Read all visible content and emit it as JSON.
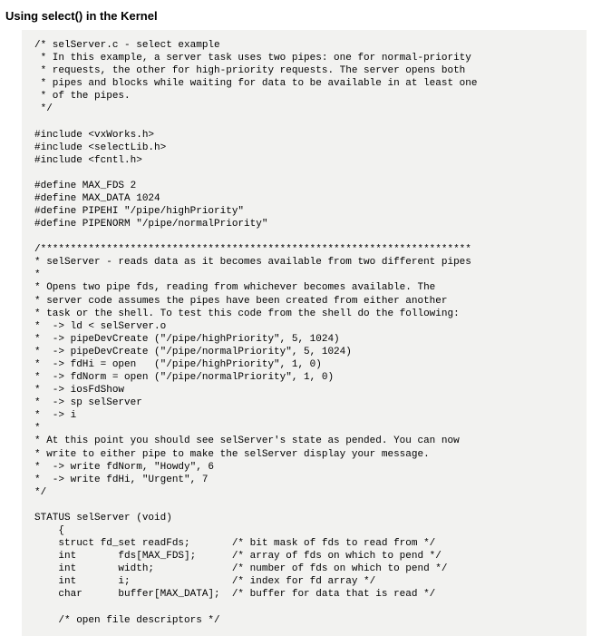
{
  "heading": "Using select() in the Kernel",
  "code": "/* selServer.c - select example\n * In this example, a server task uses two pipes: one for normal-priority\n * requests, the other for high-priority requests. The server opens both\n * pipes and blocks while waiting for data to be available in at least one\n * of the pipes.\n */\n\n#include <vxWorks.h>\n#include <selectLib.h>\n#include <fcntl.h>\n\n#define MAX_FDS 2\n#define MAX_DATA 1024\n#define PIPEHI \"/pipe/highPriority\"\n#define PIPENORM \"/pipe/normalPriority\"\n\n/************************************************************************\n* selServer - reads data as it becomes available from two different pipes\n*\n* Opens two pipe fds, reading from whichever becomes available. The\n* server code assumes the pipes have been created from either another\n* task or the shell. To test this code from the shell do the following:\n*  -> ld < selServer.o\n*  -> pipeDevCreate (\"/pipe/highPriority\", 5, 1024)\n*  -> pipeDevCreate (\"/pipe/normalPriority\", 5, 1024)\n*  -> fdHi = open   (\"/pipe/highPriority\", 1, 0)\n*  -> fdNorm = open (\"/pipe/normalPriority\", 1, 0)\n*  -> iosFdShow\n*  -> sp selServer\n*  -> i\n*\n* At this point you should see selServer's state as pended. You can now\n* write to either pipe to make the selServer display your message.\n*  -> write fdNorm, \"Howdy\", 6\n*  -> write fdHi, \"Urgent\", 7\n*/\n\nSTATUS selServer (void)\n    {\n    struct fd_set readFds;       /* bit mask of fds to read from */\n    int       fds[MAX_FDS];      /* array of fds on which to pend */\n    int       width;             /* number of fds on which to pend */\n    int       i;                 /* index for fd array */\n    char      buffer[MAX_DATA];  /* buffer for data that is read */\n\n    /* open file descriptors */"
}
